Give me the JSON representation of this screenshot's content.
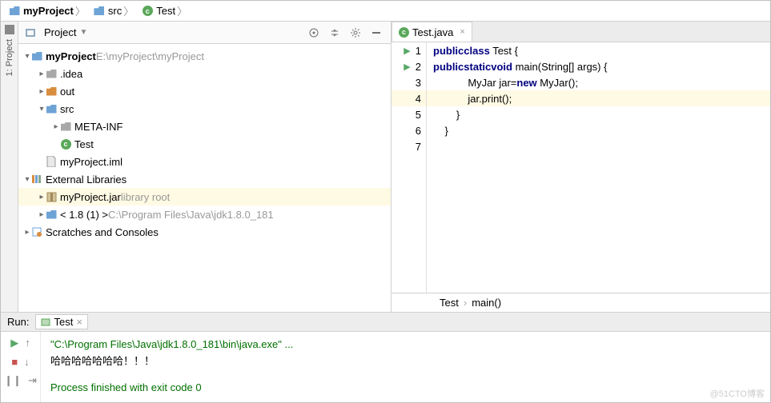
{
  "breadcrumbs": [
    {
      "label": "myProject",
      "icon": "folder-blue",
      "bold": true
    },
    {
      "label": "src",
      "icon": "folder-blue"
    },
    {
      "label": "Test",
      "icon": "class"
    }
  ],
  "sidebar": {
    "label": "1: Project"
  },
  "projectPanel": {
    "title": "Project",
    "tree": [
      {
        "depth": 0,
        "arrow": "down",
        "icon": "folder-blue",
        "label": "myProject",
        "suffix": " E:\\myProject\\myProject",
        "bold": true
      },
      {
        "depth": 1,
        "arrow": "right",
        "icon": "folder-gray",
        "label": ".idea"
      },
      {
        "depth": 1,
        "arrow": "right",
        "icon": "folder-orange",
        "label": "out"
      },
      {
        "depth": 1,
        "arrow": "down",
        "icon": "folder-blue",
        "label": "src"
      },
      {
        "depth": 2,
        "arrow": "right",
        "icon": "folder-gray",
        "label": "META-INF"
      },
      {
        "depth": 2,
        "arrow": "",
        "icon": "class",
        "label": "Test"
      },
      {
        "depth": 1,
        "arrow": "",
        "icon": "file",
        "label": "myProject.iml"
      },
      {
        "depth": 0,
        "arrow": "down",
        "icon": "lib",
        "label": "External Libraries"
      },
      {
        "depth": 1,
        "arrow": "right",
        "icon": "jar",
        "label": "myProject.jar",
        "suffix": " library root",
        "hl": true
      },
      {
        "depth": 1,
        "arrow": "right",
        "icon": "jdk",
        "label": "< 1.8 (1) > ",
        "suffix": "C:\\Program Files\\Java\\jdk1.8.0_181"
      },
      {
        "depth": 0,
        "arrow": "right",
        "icon": "scratch",
        "label": "Scratches and Consoles"
      }
    ]
  },
  "editor": {
    "tab": {
      "label": "Test.java"
    },
    "lines": [
      {
        "n": 1,
        "run": true,
        "segs": [
          [
            "",
            "    "
          ],
          [
            "kw",
            "public"
          ],
          [
            "",
            " "
          ],
          [
            "kw",
            "class"
          ],
          [
            "",
            " Test {"
          ]
        ]
      },
      {
        "n": 2,
        "run": true,
        "segs": [
          [
            "",
            "        "
          ],
          [
            "kw",
            "public"
          ],
          [
            "",
            " "
          ],
          [
            "kw",
            "static"
          ],
          [
            "",
            " "
          ],
          [
            "kw",
            "void"
          ],
          [
            "",
            " main(String[] args) {"
          ]
        ]
      },
      {
        "n": 3,
        "segs": [
          [
            "",
            "            MyJar jar="
          ],
          [
            "kw",
            "new"
          ],
          [
            "",
            " MyJar();"
          ]
        ]
      },
      {
        "n": 4,
        "hl": true,
        "segs": [
          [
            "",
            "            jar.print();"
          ]
        ]
      },
      {
        "n": 5,
        "segs": [
          [
            "",
            "        }"
          ]
        ]
      },
      {
        "n": 6,
        "segs": [
          [
            "",
            "    }"
          ]
        ]
      },
      {
        "n": 7,
        "segs": [
          [
            "",
            ""
          ]
        ]
      }
    ],
    "bcrumb": [
      "Test",
      "main()"
    ]
  },
  "run": {
    "title": "Run:",
    "tab": "Test",
    "output": [
      {
        "cls": "p",
        "text": "\"C:\\Program Files\\Java\\jdk1.8.0_181\\bin\\java.exe\" ..."
      },
      {
        "cls": "",
        "text": "哈哈哈哈哈哈哈！！！"
      },
      {
        "cls": "",
        "text": ""
      },
      {
        "cls": "p",
        "text": "Process finished with exit code 0"
      }
    ]
  },
  "watermark": "@51CTO博客"
}
